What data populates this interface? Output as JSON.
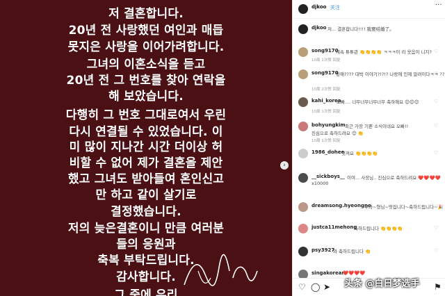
{
  "post_lines": [
    "저 결혼합니다.",
    "20년 전 사랑했던 여인과 매듭",
    "못지은 사랑을 이어가려합니다.",
    "그녀의 이혼소식을 듣고",
    "20년 전 그 번호를 찾아 연락을",
    "해 보았습니다.",
    "다행히 그 번호 그대로여서 우린",
    "다시 연결될 수 있었습니다. 이",
    "미 많이 지나간 시간 더이상 허",
    "비할 수 없어 제가 결혼을 제안",
    "했고 그녀도 받아들여 혼인신고",
    "만 하고 같이 살기로",
    "결정했습니다.",
    "저의 늦은결혼이니 만큼 여러분",
    "들의 응원과",
    "축복 부탁드립니다.",
    "감사합니다.",
    "그 중에 우리"
  ],
  "header": {
    "username": "djkoo",
    "follow_label": "关注",
    "more": "···"
  },
  "caption": {
    "username": "djkoo",
    "text": "저... 결혼합니다!!!! 我要结婚了。"
  },
  "comments": [
    {
      "user": "song9170",
      "text": "계속 튜튜관 👏👏👏👏 ㅋㅋㅋ이 리 웃음이 니지?",
      "text2": "",
      "meta": "10周   1次赞   回复"
    },
    {
      "user": "song9170",
      "text": "튕애???? 대박 이야기?!?!? 나랑에 인제 알려이다ㅋㅋ ??",
      "text2": "",
      "meta": "10周   2次赞   回复"
    },
    {
      "user": "kahi_korea",
      "text": "오빠.... 너무너무너무너무 축하해요 😊😊😊",
      "text2": "",
      "meta": "10周   1次赞   回复"
    },
    {
      "user": "bohyungkim",
      "text": "최근 가장 기쁜 소식이네요 오빠!!",
      "text2": "진심으로 축하드려요 😊 👏",
      "meta": "10周   1次赞   回复"
    },
    {
      "user": "1986_dohee",
      "text": "멋져요 👏👏👏👏",
      "text2": "",
      "meta": ""
    },
    {
      "user": "__sickboys__",
      "text": "이여... 사장님.. 진심으로 축하드려요 ❤️❤️❤️❤️",
      "text2": "x10000",
      "meta": ""
    },
    {
      "user": "dreamsong.hyeongno",
      "text": "우와~형님~멋집니다~축하드립니다~🎉",
      "text2": "",
      "meta": ""
    },
    {
      "user": "justca11mehong",
      "text": "축하드립니다 👏👏👏👏",
      "text2": "",
      "meta": ""
    },
    {
      "user": "psy3927",
      "text": "와 축하드립니다 👏",
      "text2": "",
      "meta": ""
    },
    {
      "user": "singakorean",
      "text": "❤️❤️❤️❤️",
      "text2": "",
      "meta": ""
    }
  ],
  "watermark": "头条 @白日梦选手"
}
